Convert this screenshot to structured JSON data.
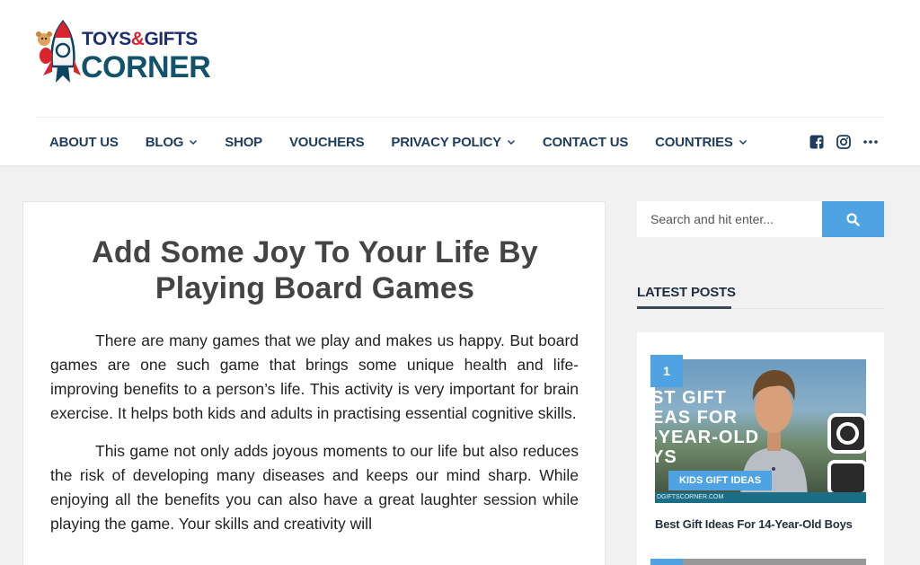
{
  "logo": {
    "line1_a": "TOYS",
    "line1_amp": "&",
    "line1_b": "GIFTS",
    "line2": "CORNER"
  },
  "nav": {
    "items": [
      {
        "label": "ABOUT US",
        "dropdown": false
      },
      {
        "label": "BLOG",
        "dropdown": true
      },
      {
        "label": "SHOP",
        "dropdown": false
      },
      {
        "label": "VOUCHERS",
        "dropdown": false
      },
      {
        "label": "PRIVACY POLICY",
        "dropdown": true
      },
      {
        "label": "CONTACT US",
        "dropdown": false
      },
      {
        "label": "COUNTRIES",
        "dropdown": true
      }
    ],
    "social_icons": [
      "facebook-icon",
      "instagram-icon",
      "more-icon"
    ]
  },
  "article": {
    "title": "Add Some Joy To Your Life By Playing Board Games",
    "paragraphs": [
      "There are many games that we play and makes us happy. But board games are one such game that brings some unique health and life-improving benefits to a person’s life. This activity is very important for brain exercise. It helps both kids and adults in practising essential cognitive skills.",
      "This game not only adds joyous moments to our life but also reduces the risk of developing many diseases and keeps our mind sharp. While enjoying all the benefits you can also have a great laughter session while playing the game. Your skills and creativity will"
    ]
  },
  "search": {
    "placeholder": "Search and hit enter..."
  },
  "sidebar": {
    "widget_title": "LATEST POSTS",
    "posts": [
      {
        "number": "1",
        "category": "KIDS GIFT IDEAS",
        "title": "Best Gift Ideas For 14-Year-Old Boys",
        "image_headline": "ST GIFT\nEAS FOR\n-YEAR-OLD\nYS",
        "image_footer": "DGIFTSCORNER.COM"
      }
    ]
  },
  "colors": {
    "accent": "#4fa3e3",
    "nav_text": "#1f3d5c",
    "title": "#444444",
    "background": "#f1f1f1"
  }
}
